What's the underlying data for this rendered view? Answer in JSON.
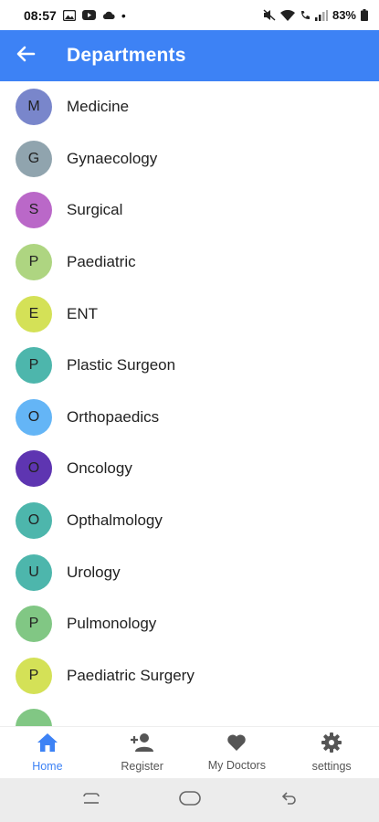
{
  "status_bar": {
    "time": "08:57",
    "dot": "•",
    "battery": "83%"
  },
  "app_bar": {
    "title": "Departments",
    "back_icon": "arrow-left-icon",
    "color": "#3d82f5"
  },
  "departments": [
    {
      "initial": "M",
      "name": "Medicine",
      "color": "#7986cb"
    },
    {
      "initial": "G",
      "name": "Gynaecology",
      "color": "#90a4ae"
    },
    {
      "initial": "S",
      "name": "Surgical",
      "color": "#ba68c8"
    },
    {
      "initial": "P",
      "name": "Paediatric",
      "color": "#aed581"
    },
    {
      "initial": "E",
      "name": "ENT",
      "color": "#d4e157"
    },
    {
      "initial": "P",
      "name": "Plastic Surgeon",
      "color": "#4db6ac"
    },
    {
      "initial": "O",
      "name": "Orthopaedics",
      "color": "#64b5f6"
    },
    {
      "initial": "O",
      "name": "Oncology",
      "color": "#5e35b1"
    },
    {
      "initial": "O",
      "name": "Opthalmology",
      "color": "#4db6ac"
    },
    {
      "initial": "U",
      "name": "Urology",
      "color": "#4db6ac"
    },
    {
      "initial": "P",
      "name": "Pulmonology",
      "color": "#81c784"
    },
    {
      "initial": "P",
      "name": "Paediatric Surgery",
      "color": "#d4e157"
    },
    {
      "initial": "",
      "name": "",
      "color": "#81c784"
    }
  ],
  "bottom_nav": {
    "items": [
      {
        "label": "Home",
        "icon": "home-icon",
        "active": true
      },
      {
        "label": "Register",
        "icon": "person-add-icon",
        "active": false
      },
      {
        "label": "My Doctors",
        "icon": "heart-icon",
        "active": false
      },
      {
        "label": "settings",
        "icon": "gear-icon",
        "active": false
      }
    ]
  },
  "system_nav": {
    "items": [
      "recent-apps-icon",
      "home-button-icon",
      "back-icon"
    ]
  }
}
